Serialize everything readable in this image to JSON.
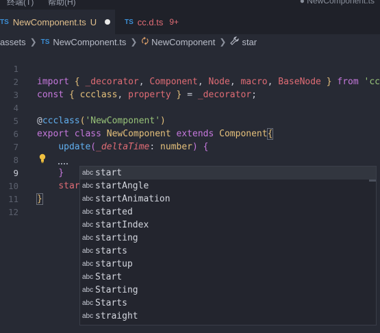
{
  "menubar": {
    "item1": "终端(T)",
    "item2": "帮助(H)",
    "window_title": "● NewComponent.ts"
  },
  "tabs": [
    {
      "icon": "TS",
      "label": "NewComponent.ts",
      "status": "U"
    },
    {
      "icon": "TS",
      "label": "cc.d.ts",
      "problems": "9+"
    }
  ],
  "breadcrumb": {
    "folder": "assets",
    "file_icon": "TS",
    "file": "NewComponent.ts",
    "class": "NewComponent",
    "symbol": "star"
  },
  "line_numbers": [
    "1",
    "2",
    "3",
    "4",
    "5",
    "6",
    "7",
    "8",
    "9",
    "10",
    "11",
    "12"
  ],
  "code": {
    "l1": {
      "kw_import": "import",
      "ob": "{",
      "a1": "_decorator",
      "c1": ",",
      "a2": "Component",
      "c2": ",",
      "a3": "Node",
      "c3": ",",
      "a4": "macro",
      "c4": ",",
      "a5": "BaseNode",
      "cb": "}",
      "kw_from": "from",
      "str": "'cc'"
    },
    "l2": {
      "kw_const": "const",
      "ob": "{",
      "a1": "ccclass",
      "c1": ",",
      "a2": "property",
      "cb": "}",
      "eq": "=",
      "rhs": "_decorator",
      "semi": ";"
    },
    "l4": {
      "at": "@",
      "dec": "ccclass",
      "op": "(",
      "str": "'NewComponent'",
      "cp": ")"
    },
    "l5": {
      "kw_export": "export",
      "kw_class": "class",
      "name": "NewComponent",
      "kw_extends": "extends",
      "base": "Component",
      "ob": "{"
    },
    "l6": {
      "fn": "update",
      "op": "(",
      "param": "_deltaTime",
      "colon": ":",
      "type": "number",
      "cp": ")",
      "ob": "{"
    },
    "l8": {
      "cb": "}"
    },
    "l9": {
      "typed": "star"
    },
    "l10": {
      "cb": "}"
    }
  },
  "suggestions": {
    "kind_label": "abc",
    "items": [
      "start",
      "startAngle",
      "startAnimation",
      "started",
      "startIndex",
      "starting",
      "starts",
      "startup",
      "Start",
      "Starting",
      "Starts",
      "straight"
    ],
    "selected_index": 0
  },
  "colors": {
    "editor_bg": "#272a34",
    "keyword": "#c678dd",
    "string": "#98c379",
    "function": "#61afef",
    "type": "#e5c07b"
  }
}
